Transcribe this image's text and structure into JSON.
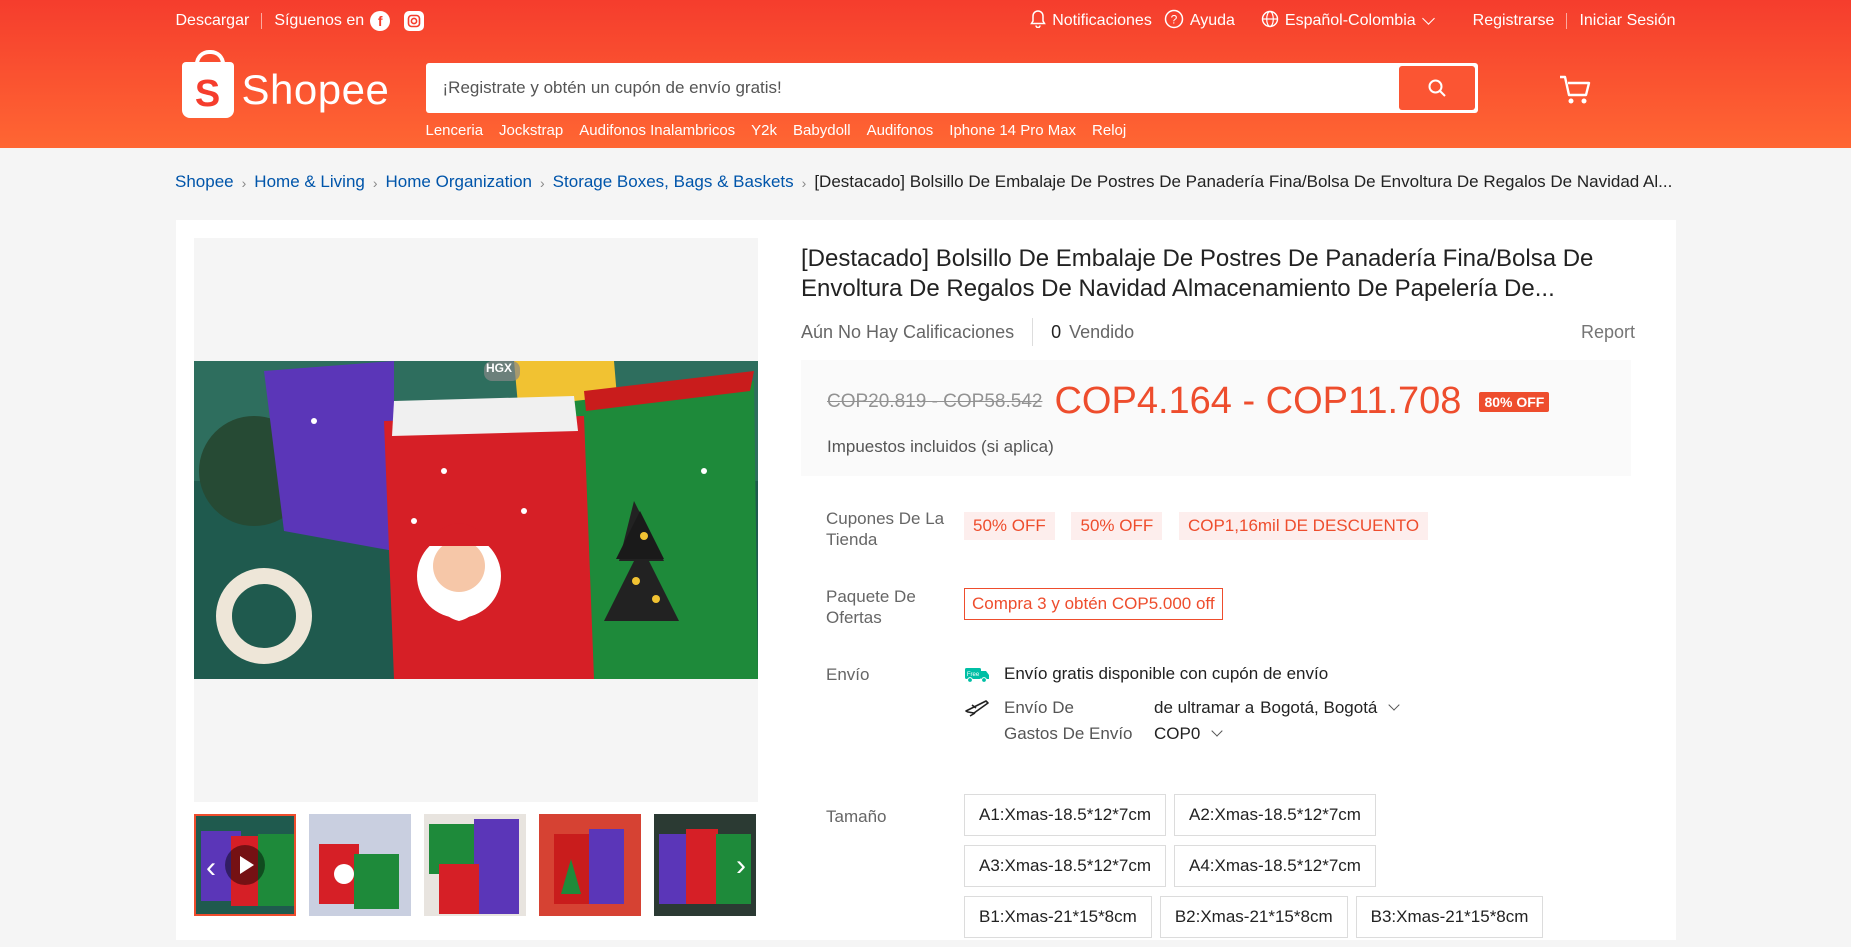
{
  "topbar": {
    "download": "Descargar",
    "follow": "Síguenos en",
    "notifications": "Notificaciones",
    "help": "Ayuda",
    "language": "Español-Colombia",
    "register": "Registrarse",
    "login": "Iniciar Sesión"
  },
  "brand": {
    "name": "Shopee",
    "letter": "S"
  },
  "search": {
    "placeholder": "¡Registrate y obtén un cupón de envío gratis!",
    "hints": [
      "Lenceria",
      "Jockstrap",
      "Audifonos Inalambricos",
      "Y2k",
      "Babydoll",
      "Audifonos",
      "Iphone 14 Pro Max",
      "Reloj"
    ]
  },
  "breadcrumb": {
    "items": [
      "Shopee",
      "Home & Living",
      "Home Organization",
      "Storage Boxes, Bags & Baskets"
    ],
    "current": "[Destacado] Bolsillo De Embalaje De Postres De Panadería Fina/Bolsa De Envoltura De Regalos De Navidad Al..."
  },
  "gallery": {
    "video_badge": "HGX"
  },
  "product": {
    "title": "[Destacado] Bolsillo De Embalaje De Postres De Panadería Fina/Bolsa De Envoltura De Regalos De Navidad Almacenamiento De Papelería De...",
    "ratings": "Aún No Hay Calificaciones",
    "sold_count": "0",
    "sold_label": "Vendido",
    "report": "Report",
    "old_price": "COP20.819 - COP58.542",
    "price": "COP4.164 - COP11.708",
    "discount": "80% OFF",
    "tax_note": "Impuestos incluidos (si aplica)"
  },
  "vouchers": {
    "label": "Cupones De La Tienda",
    "items": [
      "50% OFF",
      "50% OFF",
      "COP1,16mil DE DESCUENTO"
    ]
  },
  "bundle": {
    "label": "Paquete De Ofertas",
    "deal": "Compra 3 y obtén COP5.000 off"
  },
  "shipping": {
    "label": "Envío",
    "free_badge": "Free",
    "free_text": "Envío gratis disponible con cupón de envío",
    "from_label": "Envío De",
    "from_value": "de ultramar a",
    "destination": "Bogotá, Bogotá",
    "cost_label": "Gastos De Envío",
    "cost_value": "COP0"
  },
  "size": {
    "label": "Tamaño",
    "options": [
      "A1:Xmas-18.5*12*7cm",
      "A2:Xmas-18.5*12*7cm",
      "A3:Xmas-18.5*12*7cm",
      "A4:Xmas-18.5*12*7cm",
      "B1:Xmas-21*15*8cm",
      "B2:Xmas-21*15*8cm",
      "B3:Xmas-21*15*8cm"
    ]
  },
  "colors": {
    "brand": "#ee4d2d",
    "link": "#0055aa"
  }
}
